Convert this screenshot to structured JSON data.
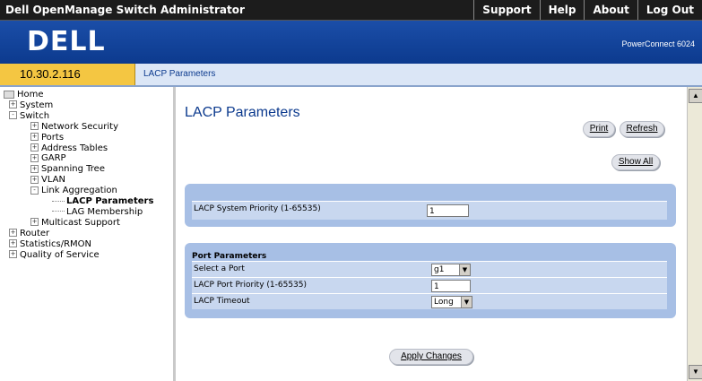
{
  "top_bar": {
    "app_title": "Dell OpenManage Switch Administrator",
    "links": [
      "Support",
      "Help",
      "About",
      "Log Out"
    ]
  },
  "banner": {
    "logo": "DELL",
    "model": "PowerConnect 6024"
  },
  "ip_bar": {
    "ip": "10.30.2.116",
    "breadcrumb": "LACP Parameters"
  },
  "tree": [
    {
      "label": "Home",
      "level": 0,
      "icon": "home-icon"
    },
    {
      "label": "System",
      "level": 1,
      "toggle": "+"
    },
    {
      "label": "Switch",
      "level": 1,
      "toggle": "-"
    },
    {
      "label": "Network Security",
      "level": 2,
      "toggle": "+"
    },
    {
      "label": "Ports",
      "level": 2,
      "toggle": "+"
    },
    {
      "label": "Address Tables",
      "level": 2,
      "toggle": "+"
    },
    {
      "label": "GARP",
      "level": 2,
      "toggle": "+"
    },
    {
      "label": "Spanning Tree",
      "level": 2,
      "toggle": "+"
    },
    {
      "label": "VLAN",
      "level": 2,
      "toggle": "+"
    },
    {
      "label": "Link Aggregation",
      "level": 2,
      "toggle": "-"
    },
    {
      "label": "LACP Parameters",
      "level": 3,
      "selected": true
    },
    {
      "label": "LAG Membership",
      "level": 3
    },
    {
      "label": "Multicast Support",
      "level": 2,
      "toggle": "+"
    },
    {
      "label": "Router",
      "level": 1,
      "toggle": "+"
    },
    {
      "label": "Statistics/RMON",
      "level": 1,
      "toggle": "+"
    },
    {
      "label": "Quality of Service",
      "level": 1,
      "toggle": "+"
    }
  ],
  "content": {
    "title": "LACP Parameters",
    "print_label": "Print",
    "refresh_label": "Refresh",
    "show_all_label": "Show All",
    "system_priority_label": "LACP System Priority (1-65535)",
    "system_priority_value": "1",
    "port_params_header": "Port Parameters",
    "select_port_label": "Select a Port",
    "select_port_value": "g1",
    "port_priority_label": "LACP Port Priority (1-65535)",
    "port_priority_value": "1",
    "timeout_label": "LACP Timeout",
    "timeout_value": "Long",
    "apply_label": "Apply Changes"
  }
}
